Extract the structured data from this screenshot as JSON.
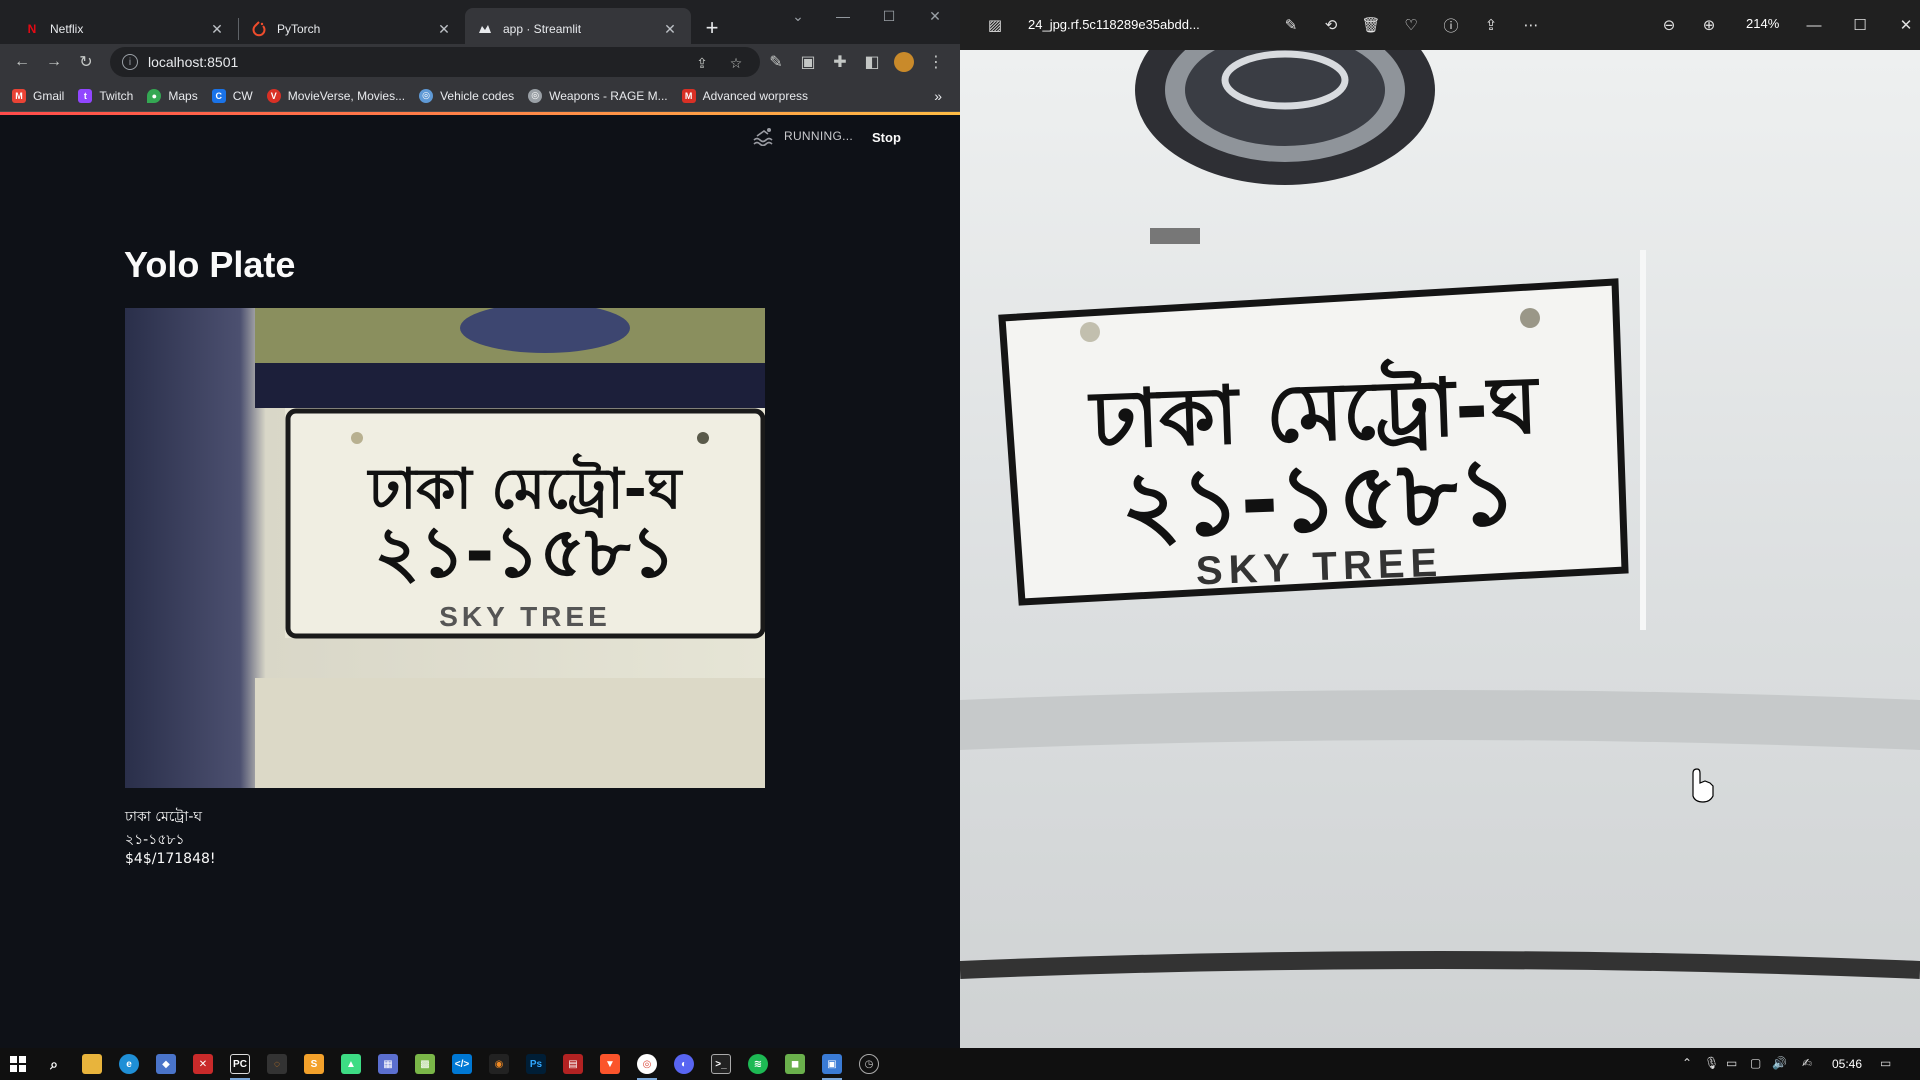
{
  "browser": {
    "tabs": [
      {
        "title": "Netflix",
        "icon": "netflix-icon",
        "active": false
      },
      {
        "title": "PyTorch",
        "icon": "pytorch-icon",
        "active": false
      },
      {
        "title": "app · Streamlit",
        "icon": "streamlit-icon",
        "active": true
      }
    ],
    "url": "localhost:8501",
    "bookmarks": [
      {
        "label": "Gmail",
        "icon": "gmail-icon",
        "color": "#ea4335"
      },
      {
        "label": "Twitch",
        "icon": "twitch-icon",
        "color": "#9146ff"
      },
      {
        "label": "Maps",
        "icon": "maps-icon",
        "color": "#34a853"
      },
      {
        "label": "CW",
        "icon": "cw-icon",
        "color": "#1a73e8"
      },
      {
        "label": "MovieVerse, Movies...",
        "icon": "movieverse-icon",
        "color": "#d93025"
      },
      {
        "label": "Vehicle codes",
        "icon": "globe-icon",
        "color": "#5f9ad6"
      },
      {
        "label": "Weapons - RAGE M...",
        "icon": "globe-icon",
        "color": "#9aa0a6"
      },
      {
        "label": "Advanced worpress",
        "icon": "m-icon",
        "color": "#d93025"
      }
    ]
  },
  "streamlit": {
    "status": "RUNNING...",
    "stop_label": "Stop",
    "title": "Yolo Plate",
    "outputs": [
      "ঢাকা মেট্রো-ঘ",
      "২১-১৫৮১",
      "$4$/171848!"
    ],
    "plate": {
      "line1": "ঢাকা মেট্রো-ঘ",
      "line2": "২১-১৫৮১",
      "line3": "SKY TREE"
    }
  },
  "viewer": {
    "filename": "24_jpg.rf.5c118289e35abdd...",
    "zoom": "214%"
  },
  "taskbar": {
    "time": "05:46"
  }
}
